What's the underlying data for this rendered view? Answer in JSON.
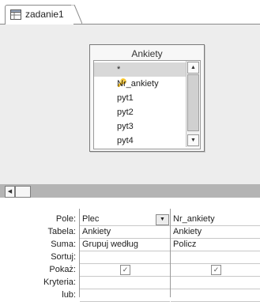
{
  "tab": {
    "title": "zadanie1"
  },
  "table": {
    "title": "Ankiety",
    "fields": [
      "*",
      "Nr_ankiety",
      "pyt1",
      "pyt2",
      "pyt3",
      "pyt4"
    ]
  },
  "grid": {
    "row_labels": [
      "Pole:",
      "Tabela:",
      "Suma:",
      "Sortuj:",
      "Pokaż:",
      "Kryteria:",
      "lub:"
    ],
    "columns": [
      {
        "pole": "Plec",
        "tabela": "Ankiety",
        "suma": "Grupuj według",
        "sortuj": "",
        "pokaz": true,
        "kryteria": "",
        "lub": ""
      },
      {
        "pole": "Nr_ankiety",
        "tabela": "Ankiety",
        "suma": "Policz",
        "sortuj": "",
        "pokaz": true,
        "kryteria": "",
        "lub": ""
      }
    ]
  }
}
